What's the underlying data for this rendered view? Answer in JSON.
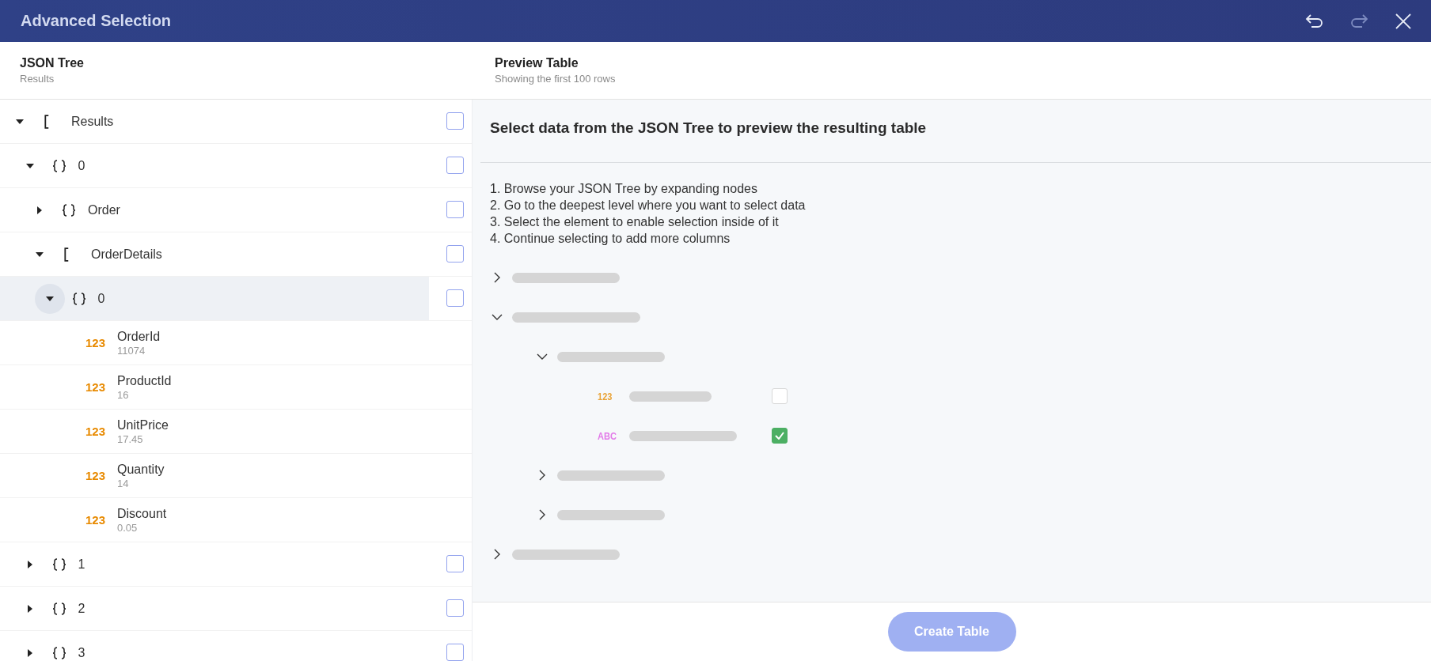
{
  "window": {
    "title": "Advanced Selection",
    "buttons": [
      {
        "kind": "undo",
        "disabled": false
      },
      {
        "kind": "redo",
        "disabled": true
      },
      {
        "kind": "close",
        "disabled": false
      }
    ]
  },
  "tree_panel": {
    "title": "JSON Tree",
    "subtitle": "Results",
    "nodes": [
      {
        "kind": "array",
        "label": "Results",
        "expanded": true,
        "selected": false,
        "checked": false,
        "children": [
          {
            "kind": "object",
            "label": "0",
            "expanded": true,
            "selected": false,
            "checked": false,
            "children": [
              {
                "kind": "object",
                "label": "Order",
                "expanded": false,
                "selected": false,
                "checked": false
              },
              {
                "kind": "array",
                "label": "OrderDetails",
                "expanded": true,
                "selected": false,
                "checked": false,
                "children": [
                  {
                    "kind": "object",
                    "label": "0",
                    "expanded": true,
                    "selected": true,
                    "checked": false,
                    "children": [
                      {
                        "kind": "number",
                        "badge": "123",
                        "label": "OrderId",
                        "value": "11074"
                      },
                      {
                        "kind": "number",
                        "badge": "123",
                        "label": "ProductId",
                        "value": "16"
                      },
                      {
                        "kind": "number",
                        "badge": "123",
                        "label": "UnitPrice",
                        "value": "17.45"
                      },
                      {
                        "kind": "number",
                        "badge": "123",
                        "label": "Quantity",
                        "value": "14"
                      },
                      {
                        "kind": "number",
                        "badge": "123",
                        "label": "Discount",
                        "value": "0.05"
                      }
                    ]
                  }
                ]
              }
            ]
          },
          {
            "kind": "object",
            "label": "1",
            "expanded": false,
            "selected": false,
            "checked": false
          },
          {
            "kind": "object",
            "label": "2",
            "expanded": false,
            "selected": false,
            "checked": false
          },
          {
            "kind": "object",
            "label": "3",
            "expanded": false,
            "selected": false,
            "checked": false
          }
        ]
      }
    ]
  },
  "preview_panel": {
    "title": "Preview Table",
    "subtitle": "Showing the first 100 rows",
    "heading": "Select data from the JSON Tree to preview the resulting table",
    "steps": [
      "1. Browse your JSON Tree by expanding nodes",
      "2. Go to the deepest level where you want to select data",
      "3. Select the element to enable selection inside of it",
      "4. Continue selecting to add more columns"
    ],
    "illustration": [
      {
        "kind": "node",
        "expanded": false
      },
      {
        "kind": "node",
        "expanded": true,
        "children": [
          {
            "kind": "node",
            "expanded": true,
            "children": [
              {
                "kind": "number",
                "badge": "123",
                "checked": false
              },
              {
                "kind": "string",
                "badge": "ABC",
                "checked": true
              }
            ]
          },
          {
            "kind": "node",
            "expanded": false
          },
          {
            "kind": "node",
            "expanded": false
          }
        ]
      },
      {
        "kind": "node",
        "expanded": false
      }
    ],
    "create_button": {
      "label": "Create Table",
      "disabled": true
    }
  }
}
